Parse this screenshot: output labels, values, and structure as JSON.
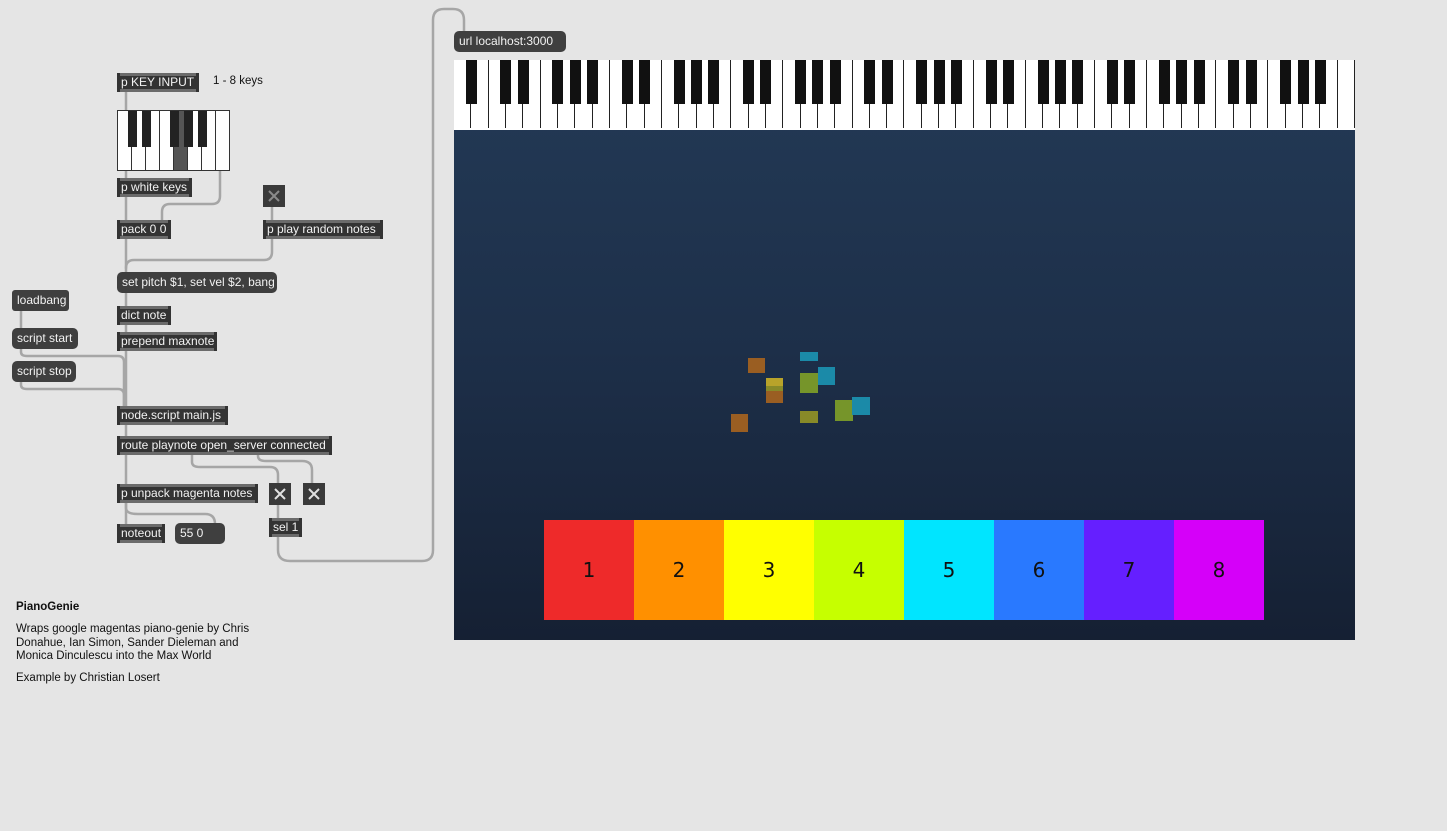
{
  "objects": {
    "key_input": "p KEY INPUT",
    "key_input_comment": "1 - 8 keys",
    "white_keys": "p white keys",
    "pack": "pack 0 0",
    "play_random": "p play random notes",
    "set_msg": "set pitch $1, set vel $2, bang",
    "loadbang": "loadbang",
    "script_start": "script start",
    "script_stop": "script stop",
    "dict_note": "dict note",
    "prepend": "prepend maxnote",
    "node_script": "node.script main.js",
    "route": "route playnote open_server connected",
    "unpack": "p unpack magenta notes",
    "noteout": "noteout",
    "number_box": "55 0",
    "sel": "sel 1",
    "url": "url localhost:3000"
  },
  "description": {
    "title": "PianoGenie",
    "body": "Wraps google magentas piano-genie by Chris Donahue, Ian Simon, Sander Dieleman and Monica Dinculescu into the Max World",
    "credit": "Example by Christian Losert"
  },
  "jweb": {
    "white_key_count": 52,
    "genie_keys": [
      {
        "label": "1",
        "color": "#ee2a2a"
      },
      {
        "label": "2",
        "color": "#ff9000"
      },
      {
        "label": "3",
        "color": "#ffff00"
      },
      {
        "label": "4",
        "color": "#c6ff00"
      },
      {
        "label": "5",
        "color": "#00e5ff"
      },
      {
        "label": "6",
        "color": "#2979ff"
      },
      {
        "label": "7",
        "color": "#651fff"
      },
      {
        "label": "8",
        "color": "#d500f9"
      }
    ]
  },
  "colors": {
    "note_orange": "#9a5e22",
    "note_yellow": "#b8a32a",
    "note_green": "#76952a",
    "note_cyan": "#1b8aa8",
    "olive": "#888a28"
  }
}
